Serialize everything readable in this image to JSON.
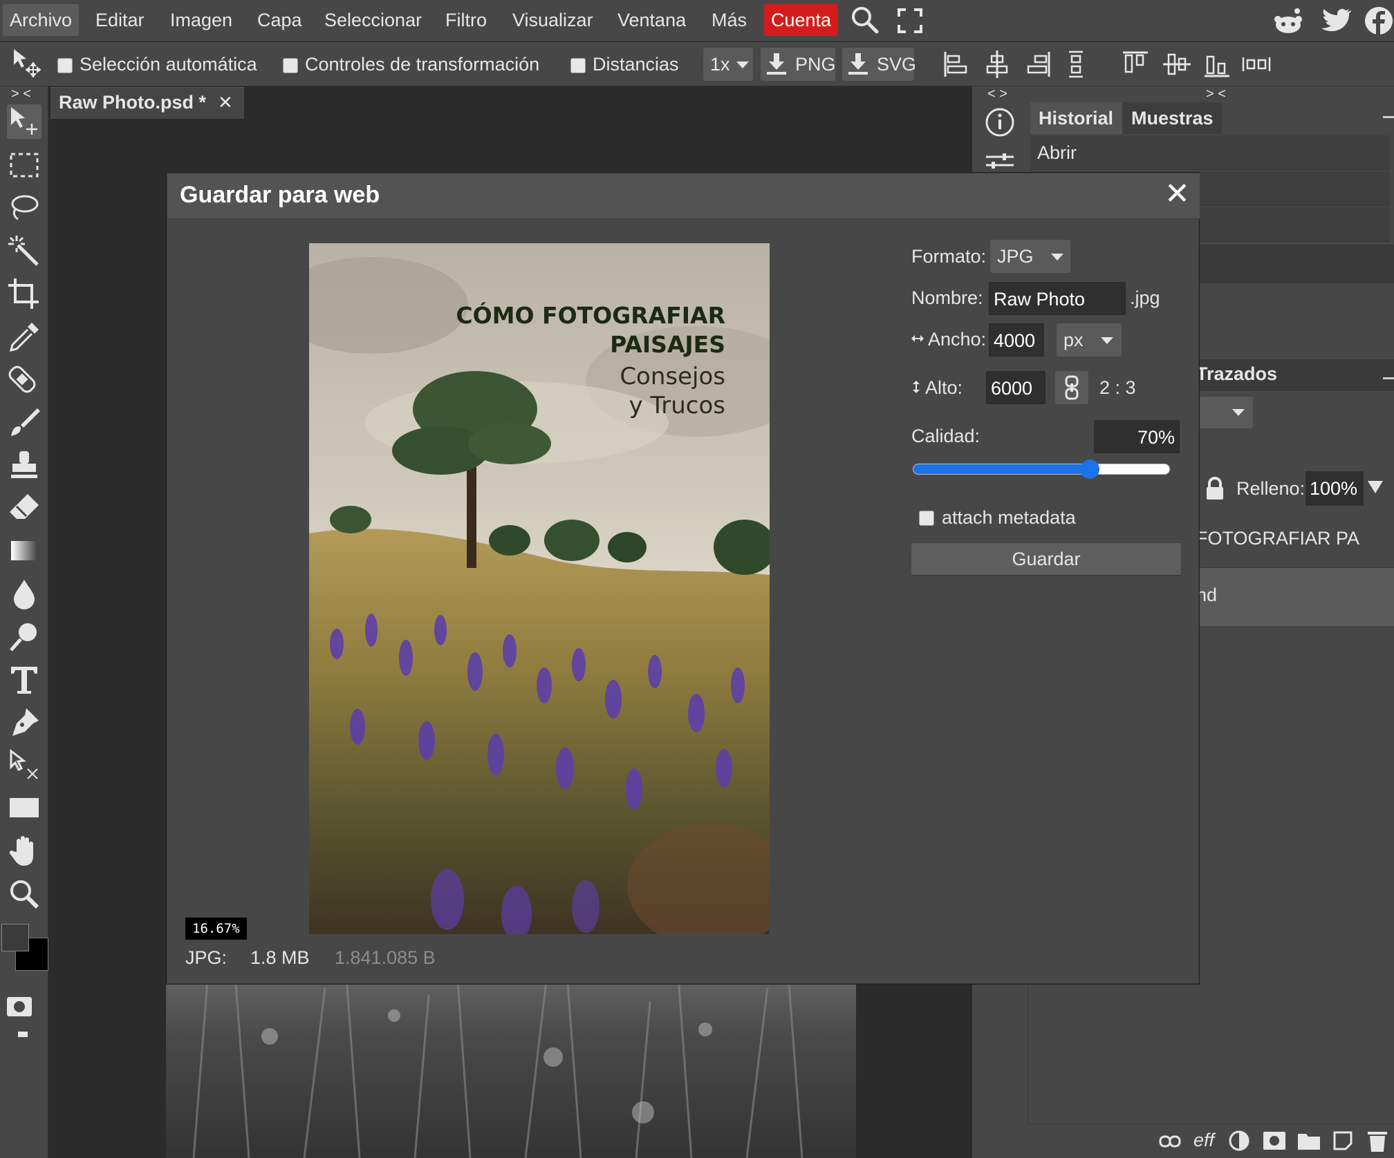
{
  "menu": {
    "items": [
      "Archivo",
      "Editar",
      "Imagen",
      "Capa",
      "Seleccionar",
      "Filtro",
      "Visualizar",
      "Ventana",
      "Más"
    ],
    "account": "Cuenta"
  },
  "options": {
    "auto_select": "Selección automática",
    "transform_controls": "Controles de transformación",
    "distances": "Distancias",
    "scale": "1x",
    "png": "PNG",
    "svg": "SVG"
  },
  "panel_toggle_left": "> <",
  "panel_toggle_mid": "< >",
  "panel_toggle_right": "> <",
  "document": {
    "tab_title": "Raw Photo.psd *",
    "close": "✕"
  },
  "panels": {
    "tabs": [
      "Historial",
      "Muestras"
    ],
    "history_item": "Abrir",
    "paths_tab": "Trazados",
    "fill_label": "Relleno:",
    "fill_value": "100%",
    "layer_text": "FOTOGRAFIAR PA",
    "layer_bg": "nd",
    "footer_eff": "eff"
  },
  "dialog": {
    "title": "Guardar para web",
    "close": "✕",
    "format_label": "Formato:",
    "format_value": "JPG",
    "name_label": "Nombre:",
    "name_value": "Raw Photo",
    "extension": ".jpg",
    "width_label": "Ancho:",
    "width_value": "4000",
    "unit": "px",
    "height_label": "Alto:",
    "height_value": "6000",
    "ratio": "2 : 3",
    "quality_label": "Calidad:",
    "quality_value": "70%",
    "quality_fraction": 0.7,
    "metadata_label": "attach metadata",
    "save_button": "Guardar",
    "zoom": "16.67%",
    "file_type": "JPG:",
    "file_size": "1.8 MB",
    "file_bytes": "1.841.085 B"
  },
  "preview": {
    "title_line1": "CÓMO FOTOGRAFIAR",
    "title_line2": "PAISAJES",
    "subtitle_line1": "Consejos",
    "subtitle_line2": "y Trucos"
  },
  "colors": {
    "accent": "#d41c1c",
    "slider": "#1a73e8",
    "panel": "#474747",
    "workspace": "#2b2b2b"
  }
}
